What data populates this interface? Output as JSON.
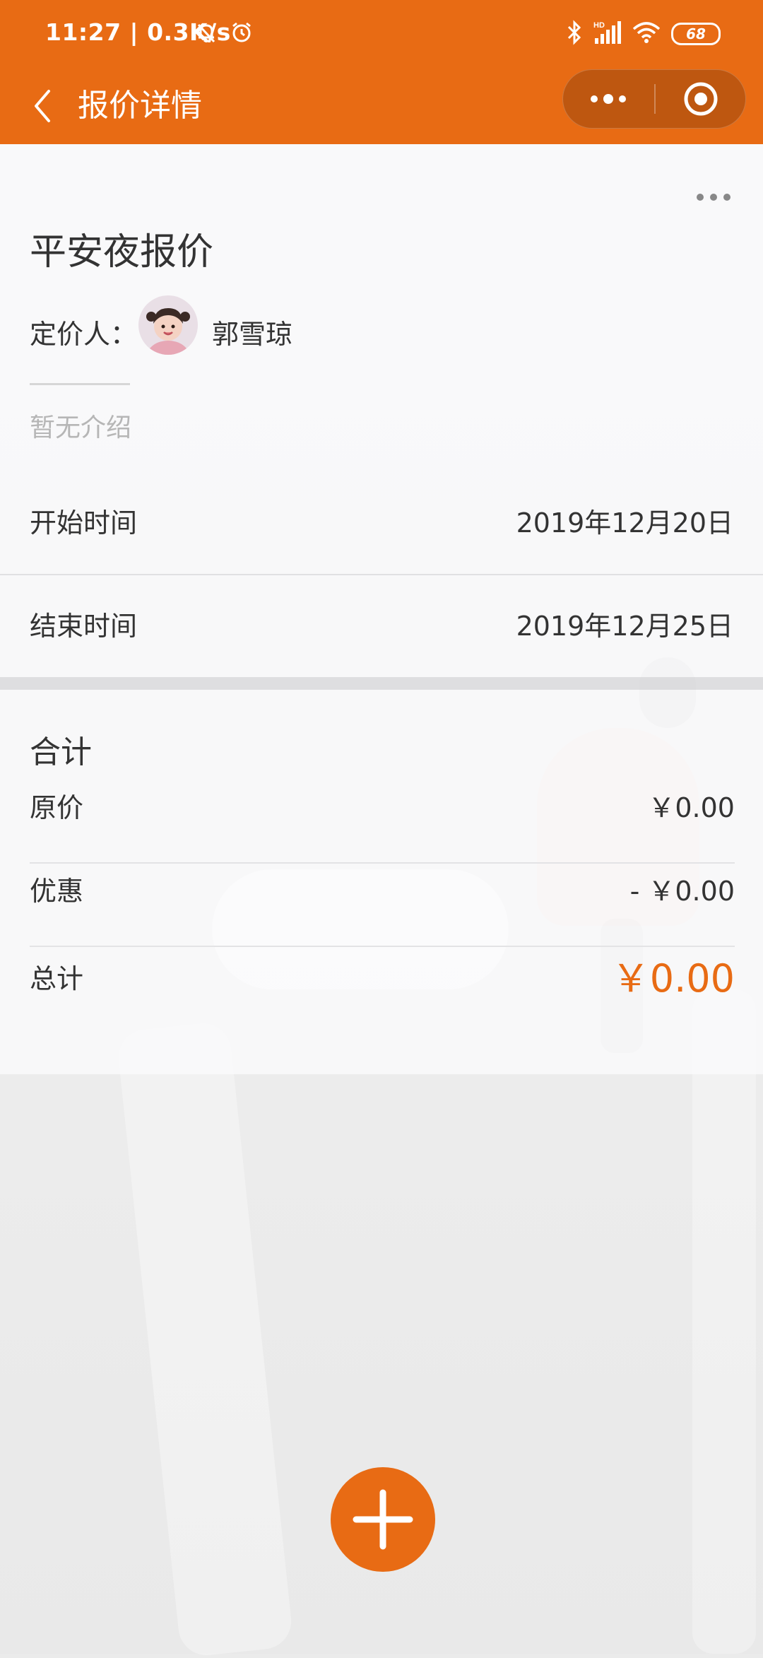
{
  "status_bar": {
    "time": "11:27",
    "speed": "0.3K/s",
    "battery": "68",
    "icons": [
      "bell-off-icon",
      "alarm-icon",
      "bluetooth-icon",
      "hd-signal-icon",
      "wifi-icon",
      "battery-icon"
    ]
  },
  "nav": {
    "title": "报价详情",
    "back_icon": "chevron-left-icon",
    "more_icon": "more-dots-icon",
    "close_icon": "target-close-icon"
  },
  "quote": {
    "title": "平安夜报价",
    "pricer_label": "定价人：",
    "pricer_name": "郭雪琼",
    "intro": "暂无介绍",
    "start_label": "开始时间",
    "start_value": "2019年12月20日",
    "end_label": "结束时间",
    "end_value": "2019年12月25日"
  },
  "totals": {
    "heading": "合计",
    "original_label": "原价",
    "original_value": "￥0.00",
    "discount_label": "优惠",
    "discount_value": "- ￥0.00",
    "total_label": "总计",
    "total_value": "￥0.00"
  },
  "colors": {
    "brand": "#e86b14",
    "text": "#333333",
    "muted": "#b6b6b6"
  },
  "fab": {
    "icon": "plus-icon"
  }
}
